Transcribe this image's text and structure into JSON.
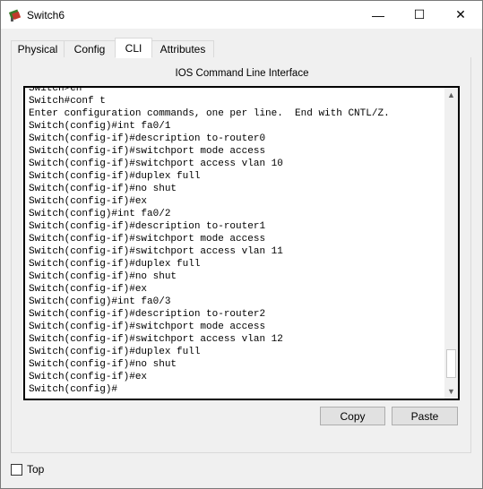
{
  "window": {
    "title": "Switch6",
    "icons": {
      "app": "network-switch-icon",
      "minimize": "minimize-icon",
      "maximize": "maximize-icon",
      "close": "close-icon"
    },
    "minimize_glyph": "—",
    "maximize_glyph": "☐",
    "close_glyph": "✕"
  },
  "tabs": [
    {
      "label": "Physical",
      "active": false
    },
    {
      "label": "Config",
      "active": false
    },
    {
      "label": "CLI",
      "active": true
    },
    {
      "label": "Attributes",
      "active": false
    }
  ],
  "cli": {
    "heading": "IOS Command Line Interface",
    "lines": [
      "Switch>en",
      "Switch#conf t",
      "Enter configuration commands, one per line.  End with CNTL/Z.",
      "Switch(config)#int fa0/1",
      "Switch(config-if)#description to-router0",
      "Switch(config-if)#switchport mode access",
      "Switch(config-if)#switchport access vlan 10",
      "Switch(config-if)#duplex full",
      "Switch(config-if)#no shut",
      "Switch(config-if)#ex",
      "Switch(config)#int fa0/2",
      "Switch(config-if)#description to-router1",
      "Switch(config-if)#switchport mode access",
      "Switch(config-if)#switchport access vlan 11",
      "Switch(config-if)#duplex full",
      "Switch(config-if)#no shut",
      "Switch(config-if)#ex",
      "Switch(config)#int fa0/3",
      "Switch(config-if)#description to-router2",
      "Switch(config-if)#switchport mode access",
      "Switch(config-if)#switchport access vlan 12",
      "Switch(config-if)#duplex full",
      "Switch(config-if)#no shut",
      "Switch(config-if)#ex",
      "Switch(config)#"
    ],
    "scroll_up_glyph": "▲",
    "scroll_down_glyph": "▼",
    "copy_label": "Copy",
    "paste_label": "Paste"
  },
  "footer": {
    "top_label": "Top",
    "top_checked": false
  }
}
